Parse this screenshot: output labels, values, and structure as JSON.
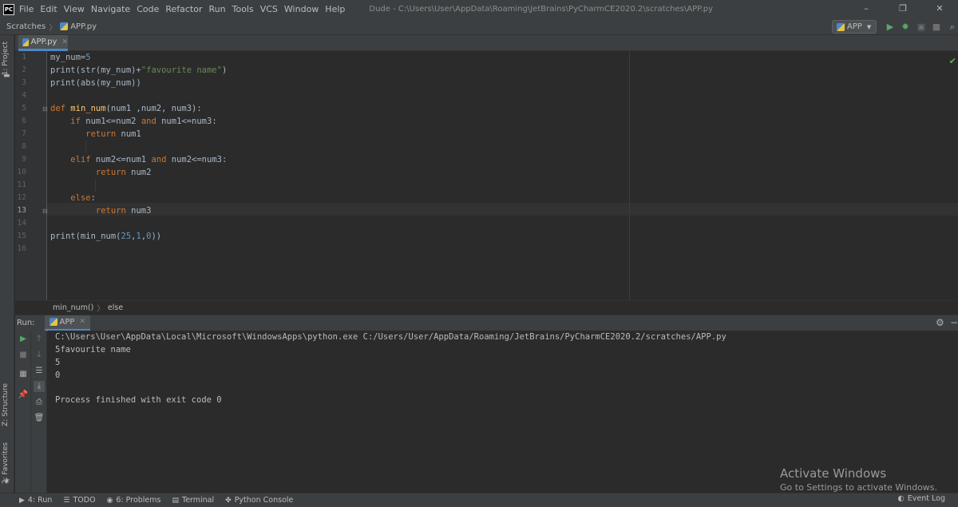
{
  "menu": {
    "items": [
      "File",
      "Edit",
      "View",
      "Navigate",
      "Code",
      "Refactor",
      "Run",
      "Tools",
      "VCS",
      "Window",
      "Help"
    ],
    "logo": "PC",
    "window_title": "Dude - C:\\Users\\User\\AppData\\Roaming\\JetBrains\\PyCharmCE2020.2\\scratches\\APP.py",
    "controls": [
      "–",
      "❐",
      "✕"
    ]
  },
  "navbar": {
    "crumb_root": "Scratches",
    "crumb_file": "APP.py",
    "run_config": "APP"
  },
  "sidebar": {
    "project": "1: Project",
    "structure": "Z: Structure",
    "favorites": "2: Favorites"
  },
  "editor": {
    "tab": "APP.py",
    "line_numbers": [
      "1",
      "2",
      "3",
      "4",
      "5",
      "6",
      "7",
      "8",
      "9",
      "10",
      "11",
      "12",
      "13",
      "14",
      "15",
      "16"
    ],
    "current_line": "13",
    "breadcrumb": [
      "min_num()",
      "else"
    ]
  },
  "run_panel": {
    "label": "Run:",
    "tab": "APP",
    "console": [
      "C:\\Users\\User\\AppData\\Local\\Microsoft\\WindowsApps\\python.exe C:/Users/User/AppData/Roaming/JetBrains/PyCharmCE2020.2/scratches/APP.py",
      "5favourite name",
      "5",
      "0",
      "",
      "Process finished with exit code 0"
    ]
  },
  "watermark": {
    "title": "Activate Windows",
    "subtitle": "Go to Settings to activate Windows."
  },
  "statusbar": {
    "run": "4: Run",
    "todo": "TODO",
    "problems": "6: Problems",
    "terminal": "Terminal",
    "python_console": "Python Console",
    "event_log": "Event Log"
  }
}
